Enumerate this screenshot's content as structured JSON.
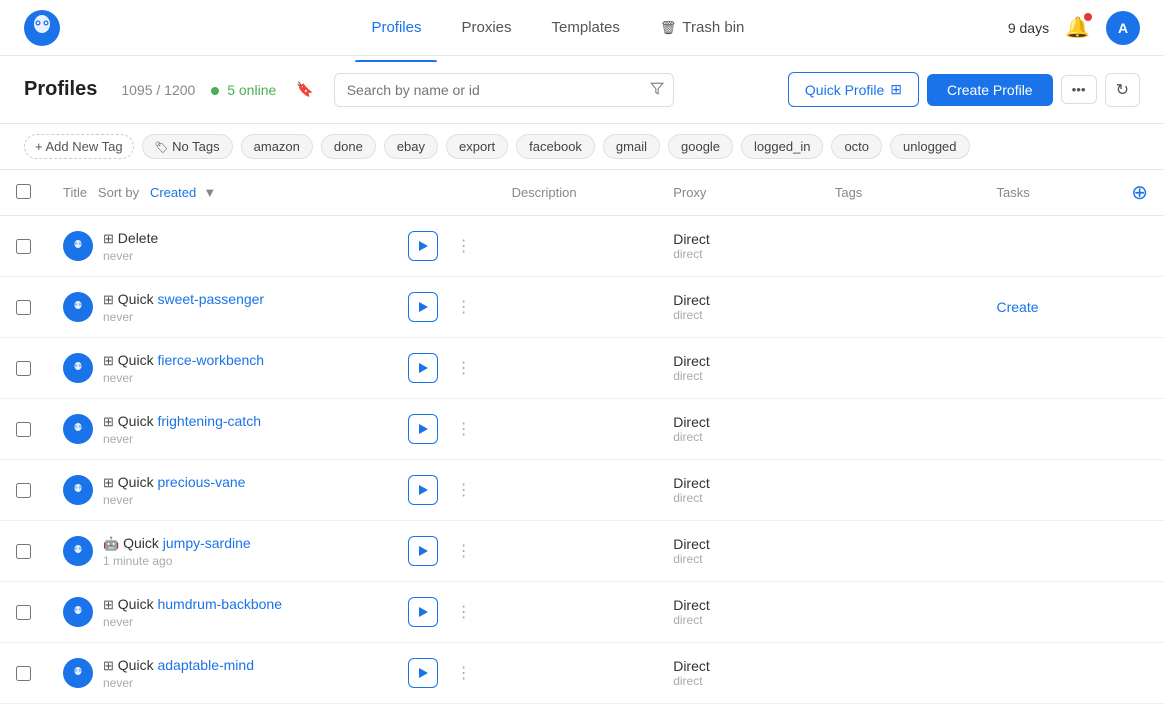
{
  "app": {
    "logo_alt": "Octobrowser logo"
  },
  "nav": {
    "links": [
      {
        "label": "Profiles",
        "active": true
      },
      {
        "label": "Proxies",
        "active": false
      },
      {
        "label": "Templates",
        "active": false
      },
      {
        "label": "Trash bin",
        "active": false,
        "icon": "trash-icon"
      }
    ],
    "days_label": "9 days",
    "bell_icon": "bell-icon",
    "avatar_initials": "A"
  },
  "header": {
    "title": "Profiles",
    "count_label": "1095 / 1200",
    "online_count": "5 online",
    "search_placeholder": "Search by name or id",
    "quick_profile_label": "Quick Profile",
    "create_profile_label": "Create Profile",
    "more_icon": "...",
    "refresh_icon": "↻"
  },
  "tags": {
    "add_label": "+ Add New Tag",
    "items": [
      {
        "label": "No Tags",
        "active": false
      },
      {
        "label": "amazon",
        "active": false
      },
      {
        "label": "done",
        "active": false
      },
      {
        "label": "ebay",
        "active": false
      },
      {
        "label": "export",
        "active": false
      },
      {
        "label": "facebook",
        "active": false
      },
      {
        "label": "gmail",
        "active": false
      },
      {
        "label": "google",
        "active": false
      },
      {
        "label": "logged_in",
        "active": false
      },
      {
        "label": "octo",
        "active": false
      },
      {
        "label": "unlogged",
        "active": false
      }
    ]
  },
  "table": {
    "columns": {
      "title": "Title",
      "sort_by": "Sort by",
      "sort_field": "Created",
      "description": "Description",
      "proxy": "Proxy",
      "tags": "Tags",
      "tasks": "Tasks"
    },
    "rows": [
      {
        "id": 1,
        "name": "Delete",
        "name_highlight": "",
        "time": "never",
        "os": "windows",
        "proxy_main": "Direct",
        "proxy_sub": "direct",
        "tags": "",
        "tasks": "",
        "create_task": false
      },
      {
        "id": 2,
        "name": "Quick sweet-passenger",
        "name_highlight": "sweet-passenger",
        "name_prefix": "Quick ",
        "time": "never",
        "os": "windows",
        "proxy_main": "Direct",
        "proxy_sub": "direct",
        "tags": "",
        "tasks": "Create",
        "create_task": true
      },
      {
        "id": 3,
        "name": "Quick fierce-workbench",
        "name_prefix": "Quick ",
        "name_highlight": "fierce-workbench",
        "time": "never",
        "os": "windows",
        "proxy_main": "Direct",
        "proxy_sub": "direct",
        "tags": "",
        "tasks": "",
        "create_task": false
      },
      {
        "id": 4,
        "name": "Quick frightening-catch",
        "name_prefix": "Quick ",
        "name_highlight": "frightening-catch",
        "time": "never",
        "os": "windows",
        "proxy_main": "Direct",
        "proxy_sub": "direct",
        "tags": "",
        "tasks": "",
        "create_task": false
      },
      {
        "id": 5,
        "name": "Quick precious-vane",
        "name_prefix": "Quick ",
        "name_highlight": "precious-vane",
        "time": "never",
        "os": "windows",
        "proxy_main": "Direct",
        "proxy_sub": "direct",
        "tags": "",
        "tasks": "",
        "create_task": false
      },
      {
        "id": 6,
        "name": "Quick jumpy-sardine",
        "name_prefix": "Quick ",
        "name_highlight": "jumpy-sardine",
        "time": "1 minute ago",
        "os": "android",
        "proxy_main": "Direct",
        "proxy_sub": "direct",
        "tags": "",
        "tasks": "",
        "create_task": false
      },
      {
        "id": 7,
        "name": "Quick humdrum-backbone",
        "name_prefix": "Quick ",
        "name_highlight": "humdrum-backbone",
        "time": "never",
        "os": "windows",
        "proxy_main": "Direct",
        "proxy_sub": "direct",
        "tags": "",
        "tasks": "",
        "create_task": false
      },
      {
        "id": 8,
        "name": "Quick adaptable-mind",
        "name_prefix": "Quick ",
        "name_highlight": "adaptable-mind",
        "time": "never",
        "os": "windows",
        "proxy_main": "Direct",
        "proxy_sub": "direct",
        "tags": "",
        "tasks": "",
        "create_task": false
      }
    ]
  }
}
